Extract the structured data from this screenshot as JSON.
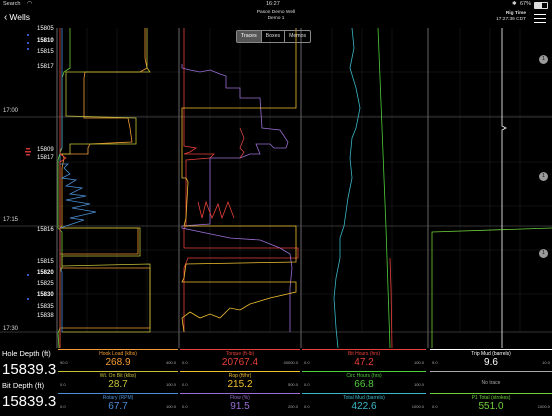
{
  "status": {
    "carrier": "Search",
    "time": "16:27",
    "battery": "67%"
  },
  "nav": {
    "back_label": "Wells",
    "well_name": "Pason Demo Well",
    "well_sub": "Demo 1",
    "rig_time_label": "Rig Time",
    "rig_time_value": "17:27:36 CDT"
  },
  "tabs": [
    {
      "label": "Traces",
      "active": true
    },
    {
      "label": "Boxes",
      "active": false
    },
    {
      "label": "Memos",
      "active": false
    }
  ],
  "time_labels": [
    "17:00",
    "17:15",
    "17:30"
  ],
  "depth_labels": [
    {
      "text": "15805",
      "bold": false
    },
    {
      "text": "15810",
      "bold": true
    },
    {
      "text": "15815",
      "bold": false
    },
    {
      "text": "15817",
      "bold": false
    },
    {
      "text": "15809",
      "bold": false
    },
    {
      "text": "15817",
      "bold": false
    },
    {
      "text": "15816",
      "bold": false
    },
    {
      "text": "15815",
      "bold": false
    },
    {
      "text": "15820",
      "bold": true
    },
    {
      "text": "15825",
      "bold": false
    },
    {
      "text": "15830",
      "bold": true
    },
    {
      "text": "15835",
      "bold": false
    },
    {
      "text": "15838",
      "bold": false
    }
  ],
  "memo_badges": [
    "1",
    "1",
    "1"
  ],
  "left_panel": {
    "hole_depth_label": "Hole Depth (ft)",
    "hole_depth_value": "15839.3",
    "bit_depth_label": "Bit Depth (ft)",
    "bit_depth_value": "15839.3"
  },
  "channels": [
    [
      {
        "title": "Hook Load (klbs)",
        "value": "268.9",
        "min": "90.0",
        "max": "400.0",
        "color": "#f39c33"
      },
      {
        "title": "Wt. On Bit (klbs)",
        "value": "28.7",
        "min": "0.0",
        "max": "100.0",
        "color": "#c8c23a"
      },
      {
        "title": "Rotary (RPM)",
        "value": "67.7",
        "min": "0.0",
        "max": "100.0",
        "color": "#4a8fd6"
      }
    ],
    [
      {
        "title": "Torque (ft-lb)",
        "value": "20767.4",
        "min": "0.0",
        "max": "40000.0",
        "color": "#e8403a"
      },
      {
        "title": "Rop (ft/hr)",
        "value": "215.2",
        "min": "0.0",
        "max": "500.0",
        "color": "#f3c030"
      },
      {
        "title": "Flow (%)",
        "value": "91.5",
        "min": "0.0",
        "max": "200.0",
        "color": "#9b6fd6"
      }
    ],
    [
      {
        "title": "Bit Hours (hrs)",
        "value": "47.2",
        "min": "0.0",
        "max": "100.0",
        "color": "#e8403a"
      },
      {
        "title": "Circ Hours (hrs)",
        "value": "66.8",
        "min": "0.0",
        "max": "100.0",
        "color": "#4fcf3a"
      },
      {
        "title": "Total Mud (barrels)",
        "value": "422.6",
        "min": "0.0",
        "max": "1000.0",
        "color": "#3ab7c8"
      }
    ],
    [
      {
        "title": "Trip Mud (barrels)",
        "value": "9.6",
        "min": "9.0",
        "max": "10.0",
        "color": "#ffffff"
      },
      {
        "title": "No trace",
        "value": "",
        "min": "",
        "max": "",
        "color": "#aaaaaa"
      },
      {
        "title": "P1 Total (strokes)",
        "value": "551.0",
        "min": "0.0",
        "max": "1000.0",
        "color": "#6fcf3a"
      }
    ]
  ]
}
